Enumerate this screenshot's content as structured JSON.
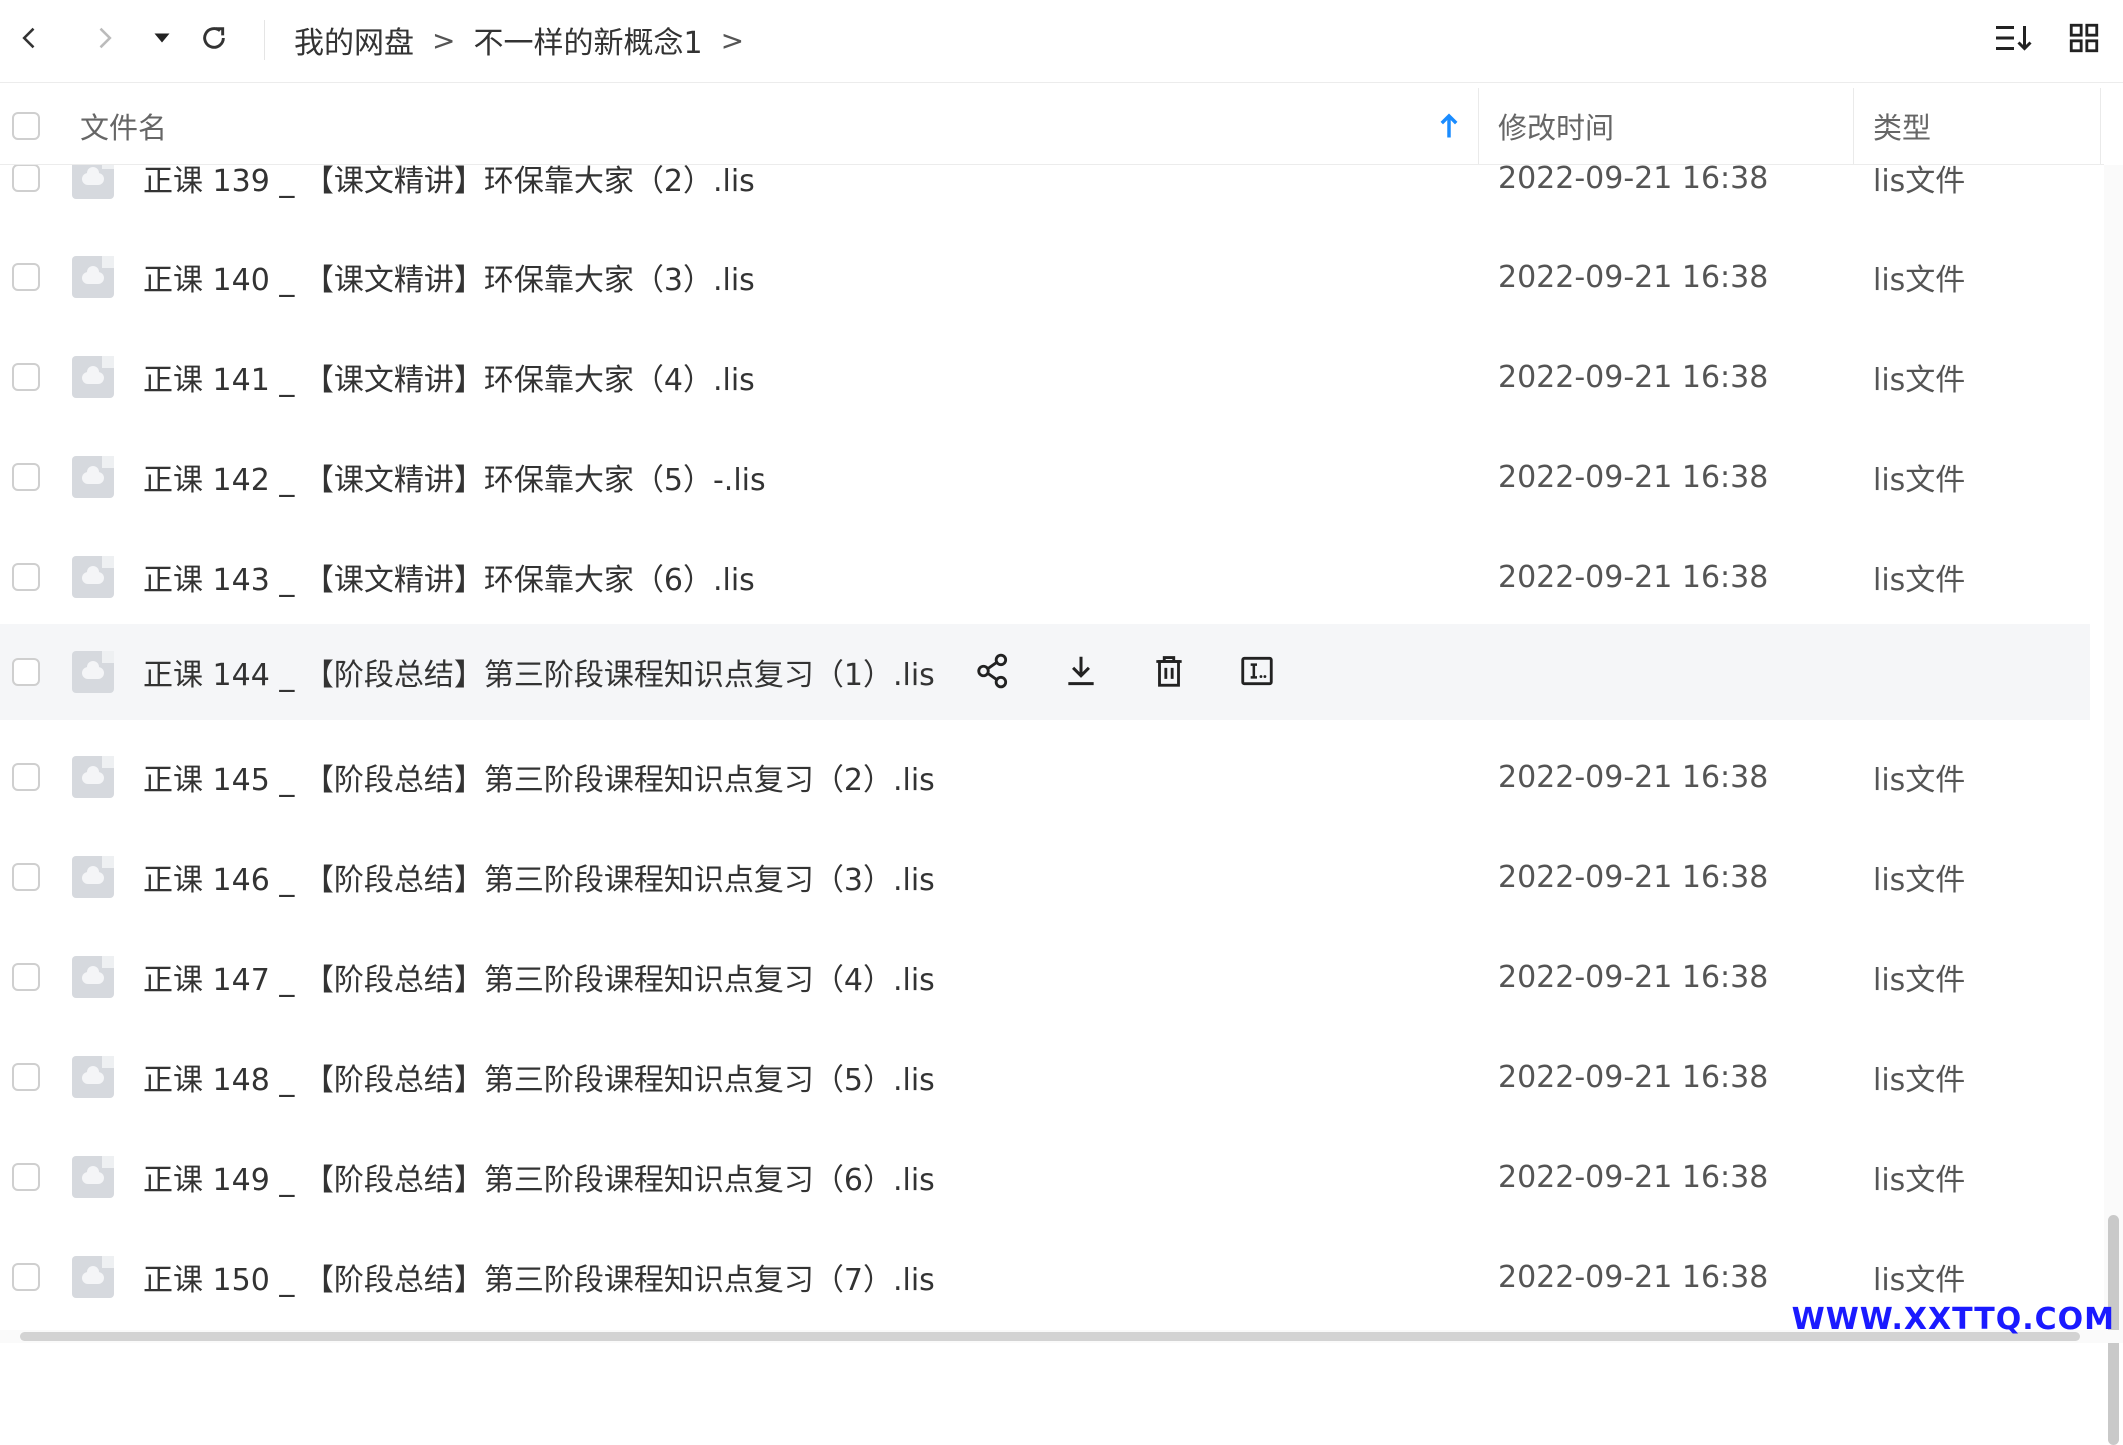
{
  "toolbar": {
    "breadcrumb": [
      "我的网盘",
      "不一样的新概念1"
    ],
    "separator": ">"
  },
  "columns": {
    "name": "文件名",
    "modified": "修改时间",
    "type": "类型"
  },
  "rows": [
    {
      "name": "正课 139 _ 【课文精讲】环保靠大家（2）.lis",
      "time": "2022-09-21 16:38",
      "type": "lis文件"
    },
    {
      "name": "正课 140 _ 【课文精讲】环保靠大家（3）.lis",
      "time": "2022-09-21 16:38",
      "type": "lis文件"
    },
    {
      "name": "正课 141 _ 【课文精讲】环保靠大家（4）.lis",
      "time": "2022-09-21 16:38",
      "type": "lis文件"
    },
    {
      "name": "正课 142 _ 【课文精讲】环保靠大家（5）-.lis",
      "time": "2022-09-21 16:38",
      "type": "lis文件"
    },
    {
      "name": "正课 143 _ 【课文精讲】环保靠大家（6）.lis",
      "time": "2022-09-21 16:38",
      "type": "lis文件"
    },
    {
      "name": "正课 144 _ 【阶段总结】第三阶段课程知识点复习（1）.lis",
      "time": "",
      "type": ""
    },
    {
      "name": "正课 145 _ 【阶段总结】第三阶段课程知识点复习（2）.lis",
      "time": "2022-09-21 16:38",
      "type": "lis文件"
    },
    {
      "name": "正课 146 _ 【阶段总结】第三阶段课程知识点复习（3）.lis",
      "time": "2022-09-21 16:38",
      "type": "lis文件"
    },
    {
      "name": "正课 147 _ 【阶段总结】第三阶段课程知识点复习（4）.lis",
      "time": "2022-09-21 16:38",
      "type": "lis文件"
    },
    {
      "name": "正课 148 _ 【阶段总结】第三阶段课程知识点复习（5）.lis",
      "time": "2022-09-21 16:38",
      "type": "lis文件"
    },
    {
      "name": "正课 149 _ 【阶段总结】第三阶段课程知识点复习（6）.lis",
      "time": "2022-09-21 16:38",
      "type": "lis文件"
    },
    {
      "name": "正课 150 _ 【阶段总结】第三阶段课程知识点复习（7）.lis",
      "time": "2022-09-21 16:38",
      "type": "lis文件"
    }
  ],
  "hover_row_index": 5,
  "hover_actions": [
    "share-icon",
    "download-icon",
    "delete-icon",
    "rename-icon"
  ],
  "icons": {
    "back": "chevron-left-icon",
    "forward": "chevron-right-icon",
    "history": "caret-down-icon",
    "refresh": "refresh-icon",
    "sort": "sort-icon",
    "view": "grid-view-icon",
    "sort_arrow": "arrow-up-icon"
  },
  "colors": {
    "accent": "#1a8cff",
    "hover_row": "#f5f6f8",
    "watermark": "#1a1aff"
  },
  "watermark": "WWW.XXTTQ.COM"
}
